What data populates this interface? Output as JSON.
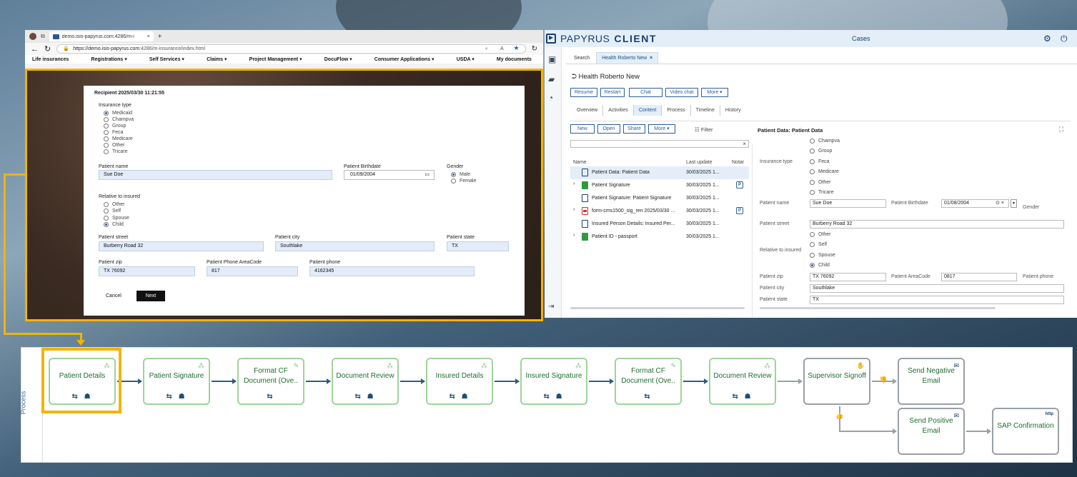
{
  "browser": {
    "tab_title": "demo.isis-papyrus.com:4286/m-i",
    "url_host": "https://demo.isis-papyrus.com",
    "url_path": ":4286/m-insurance/index.html",
    "menu": [
      "Life insurances",
      "Registrations ▾",
      "Self Services ▾",
      "Claims ▾",
      "Project Management ▾",
      "DocuFlow ▾",
      "Consumer Applications ▾",
      "USDA ▾",
      "My documents"
    ]
  },
  "form": {
    "header": "Recipient 2025/03/30 11:21:55",
    "insurance_type_label": "Insurance type",
    "insurance_options": [
      "Medicaid",
      "Champva",
      "Group",
      "Feca",
      "Medicare",
      "Other",
      "Tricare"
    ],
    "insurance_selected": "Medicaid",
    "patient_name_label": "Patient name",
    "patient_name": "Sue Doe",
    "birthdate_label": "Patient Birthdate",
    "birthdate": "01/09/2004",
    "gender_label": "Gender",
    "gender_options": [
      "Male",
      "Female"
    ],
    "relative_label": "Relative to insured",
    "relative_options": [
      "Other",
      "Self",
      "Spouse",
      "Child"
    ],
    "relative_selected": "Child",
    "street_label": "Patient street",
    "street": "Burberry Road 32",
    "city_label": "Patient city",
    "city": "Southlake",
    "state_label": "Patient state",
    "state": "TX",
    "zip_label": "Patient zip",
    "zip": "TX 76092",
    "areacode_label": "Patient Phone AreaCode",
    "areacode": "817",
    "phone_label": "Patient phone",
    "phone": "4162345",
    "cancel": "Cancel",
    "next": "Next"
  },
  "papyrus": {
    "logo_light": "PAPYRUS",
    "logo_bold": "CLIENT",
    "header_title": "Cases",
    "tabs": [
      "Search",
      "Health Roberto New"
    ],
    "tab_close": "×",
    "case_title": "Health Roberto New",
    "actions": [
      "Resume",
      "Restart",
      "Chat",
      "Video chat",
      "More ▾"
    ],
    "subtabs": [
      "Overview",
      "Activities",
      "Content",
      "Process",
      "Timeline",
      "History"
    ],
    "content_buttons": [
      "New",
      "Open",
      "Share",
      "More ▾"
    ],
    "filter": "Filter",
    "columns": [
      "Name",
      "Last update",
      "Notar"
    ],
    "rows": [
      {
        "name": "Patient Data: Patient Data",
        "date": "30/03/2025 1..."
      },
      {
        "name": "Patient Signature",
        "date": "30/03/2025 1..."
      },
      {
        "name": "Patient Signature: Patient Signature",
        "date": "30/03/2025 1..."
      },
      {
        "name": "form-cms1500_sig_ren 2025/03/30 ...",
        "date": "30/03/2025 1..."
      },
      {
        "name": "Insured Person Details: Insured Per...",
        "date": "30/03/2025 1..."
      },
      {
        "name": "Patient ID - passport",
        "date": "30/03/2025 1..."
      }
    ],
    "detail_title": "Patient Data: Patient Data",
    "detail": {
      "insurance_label": "Insurance type",
      "insurance_options": [
        "Champva",
        "Group",
        "Feca",
        "Medicare",
        "Other",
        "Tricare"
      ],
      "name_label": "Patient name",
      "name": "Sue Doe",
      "birth_label": "Patient Birthdate",
      "birth": "01/08/2004",
      "gender_label": "Gender",
      "street_label": "Patient street",
      "street": "Burberry Road 32",
      "relative_label": "Relative to insured",
      "relative_options": [
        "Other",
        "Self",
        "Spouse",
        "Child"
      ],
      "zip_label": "Patient zip",
      "zip": "TX 76092",
      "areacode_label": "Patient AreaCode",
      "areacode": "0817",
      "phone_label": "Patient phone",
      "city_label": "Patient city",
      "city": "Southlake",
      "state_label": "Patient state",
      "state": "TX"
    }
  },
  "process": {
    "lane": "Process",
    "nodes": [
      "Patient Details",
      "Patient Signature",
      "Format CF Document (Ove..",
      "Document Review",
      "Insured Details",
      "Insured Signature",
      "Format CF Document (Ove..",
      "Document Review",
      "Supervisor Signoff",
      "Send Negative Email",
      "Send Positive Email",
      "SAP Confirmation"
    ]
  },
  "colors": {
    "highlight": "#f3b400",
    "brand": "#1a3e6b",
    "node_green": "#9ed49a"
  }
}
